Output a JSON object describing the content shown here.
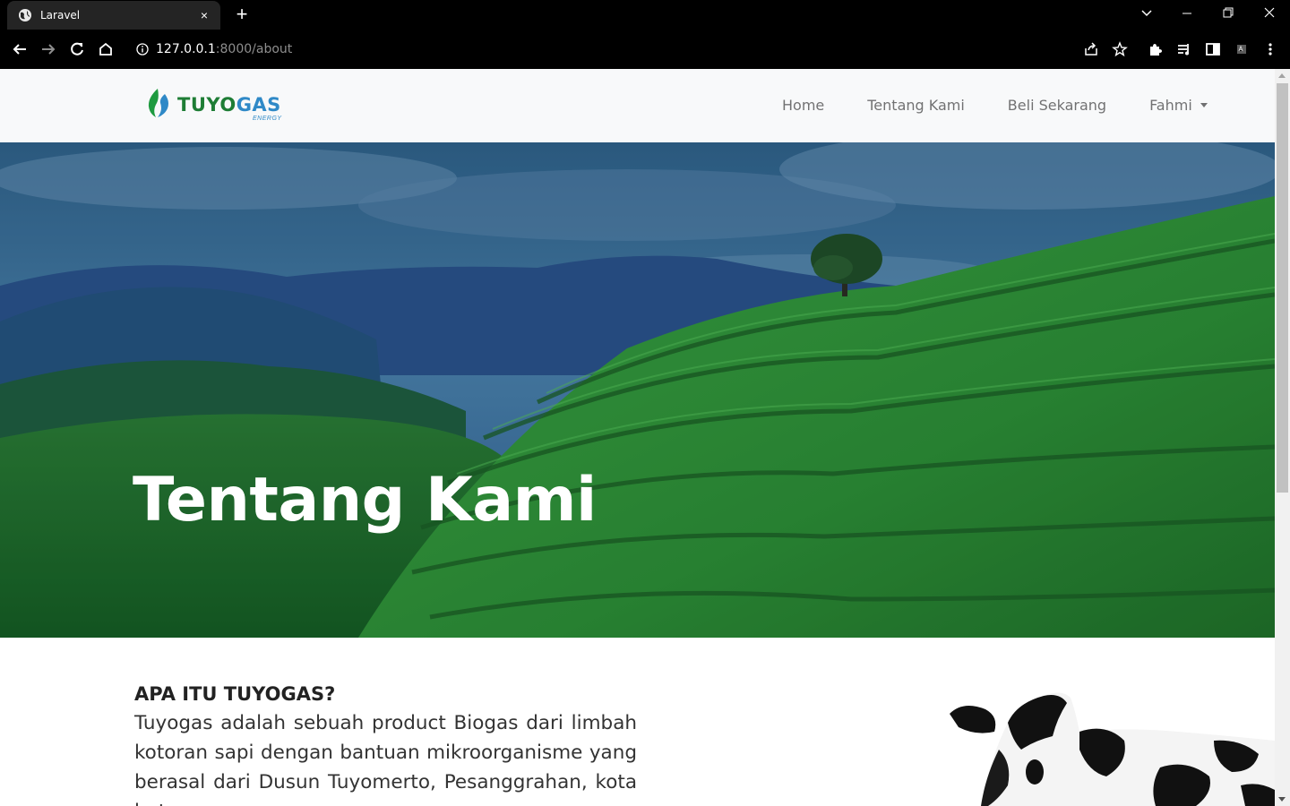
{
  "browser": {
    "tab_title": "Laravel",
    "tab_close": "×",
    "new_tab": "+",
    "url_host": "127.0.0.1",
    "url_path": ":8000/about"
  },
  "navbar": {
    "brand_tuyo": "TUYO",
    "brand_gas": "GAS",
    "brand_sub": "ENERGY",
    "links": [
      {
        "label": "Home"
      },
      {
        "label": "Tentang Kami"
      },
      {
        "label": "Beli Sekarang"
      }
    ],
    "user": "Fahmi"
  },
  "hero": {
    "title": "Tentang Kami"
  },
  "about": {
    "heading": "APA ITU TUYOGAS?",
    "body": "Tuyogas adalah sebuah product Biogas dari limbah kotoran sapi dengan bantuan mikroorganisme yang berasal dari Dusun Tuyomerto, Pesanggrahan, kota batu,"
  },
  "colors": {
    "brand_green": "#1e7d35",
    "brand_blue": "#2f89c7",
    "navbar_bg": "#f8f9fa"
  }
}
